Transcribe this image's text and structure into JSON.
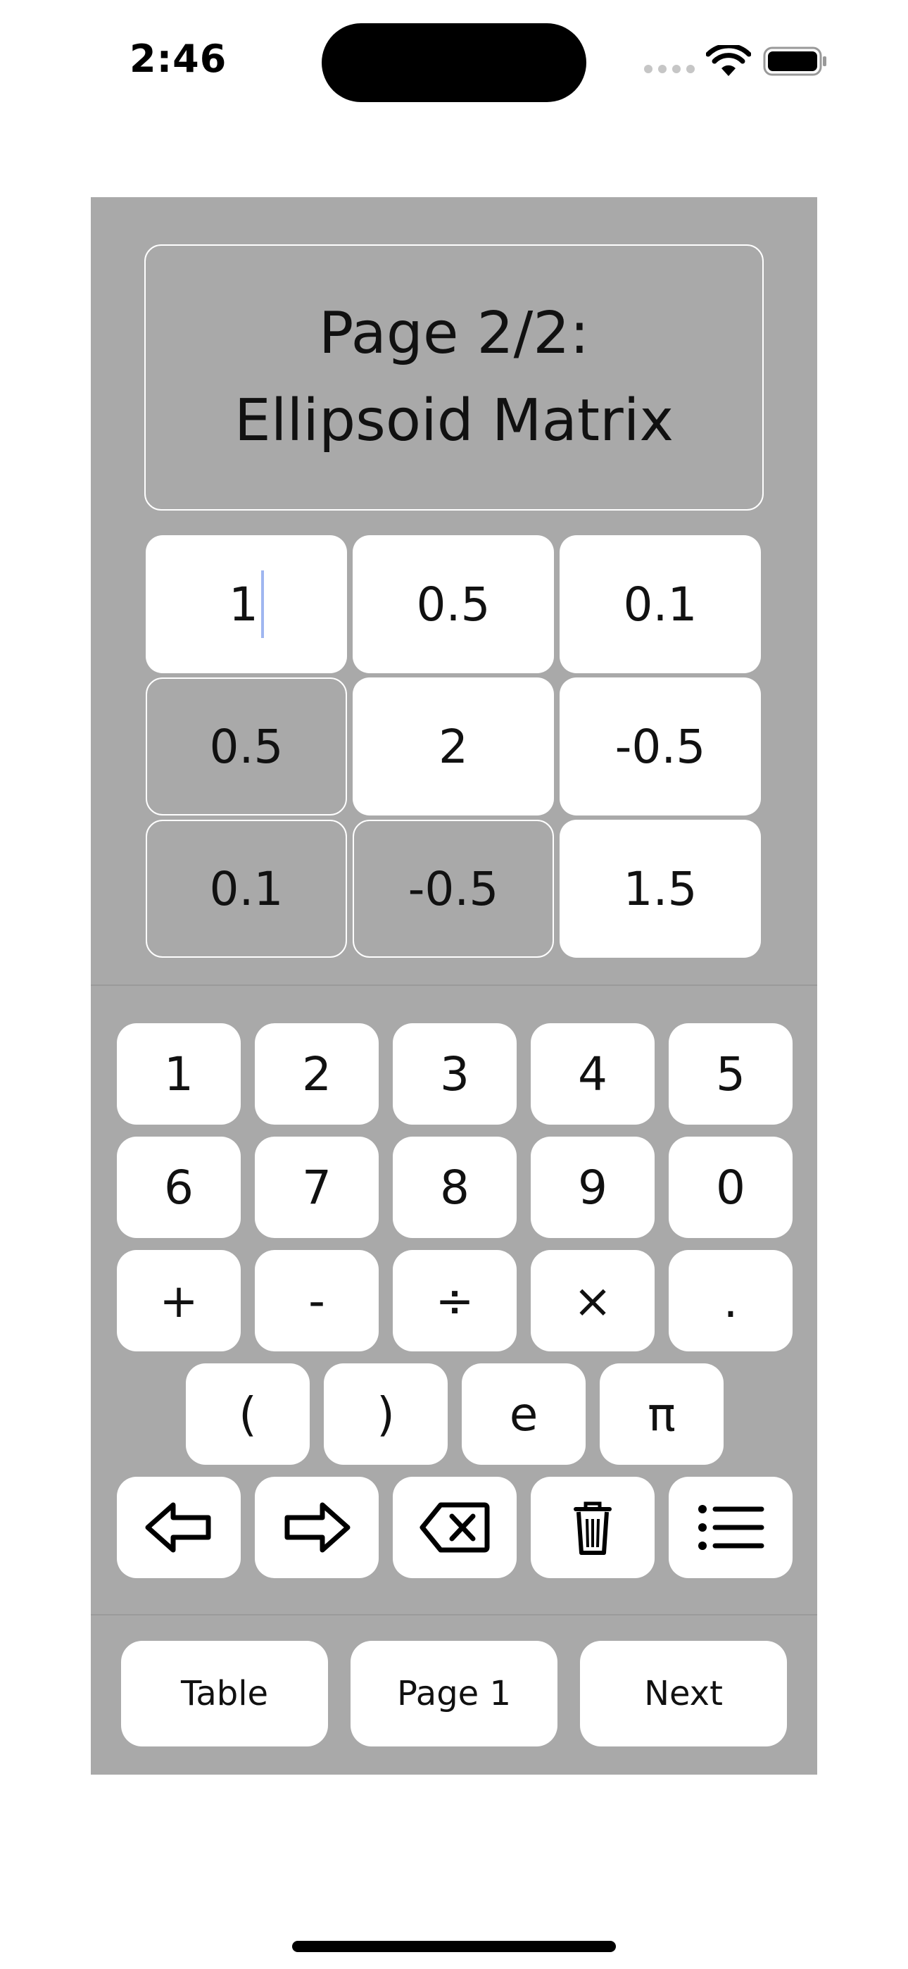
{
  "status_bar": {
    "time": "2:46"
  },
  "title": {
    "line1": "Page 2/2:",
    "line2": "Ellipsoid Matrix"
  },
  "matrix": {
    "rows": [
      [
        "1",
        "0.5",
        "0.1"
      ],
      [
        "0.5",
        "2",
        "-0.5"
      ],
      [
        "0.1",
        "-0.5",
        "1.5"
      ]
    ]
  },
  "keypad": {
    "row1": [
      "1",
      "2",
      "3",
      "4",
      "5"
    ],
    "row2": [
      "6",
      "7",
      "8",
      "9",
      "0"
    ],
    "row3": [
      "+",
      "-",
      "÷",
      "×",
      "."
    ],
    "row4": [
      "(",
      ")",
      "e",
      "π"
    ],
    "row5_icons": [
      "arrow-left-icon",
      "arrow-right-icon",
      "backspace-icon",
      "trash-icon",
      "list-icon"
    ]
  },
  "footer": {
    "table_label": "Table",
    "page1_label": "Page 1",
    "next_label": "Next"
  },
  "colors": {
    "panel_background": "#a9a9a9",
    "cell_background": "#ffffff",
    "cursor": "#9fb6f0"
  }
}
